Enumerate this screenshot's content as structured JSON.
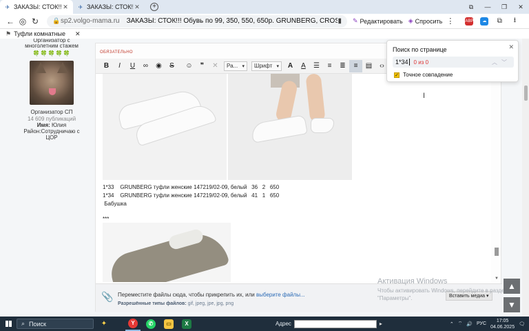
{
  "tabs": [
    {
      "label": "ЗАКАЗЫ: СТОК!!! Обувь",
      "active": true
    },
    {
      "label": "ЗАКАЗЫ: СТОК!!! Обувь",
      "active": false
    }
  ],
  "window": {
    "minimize": "—",
    "maximize": "❐",
    "close": "✕",
    "tab_list": "⧉"
  },
  "address": {
    "domain": "sp2.volgo-mama.ru",
    "page_title": "ЗАКАЗЫ: СТОК!!! Обувь по 99, 350, 550, 650р. GRUNBERG, CROSBY, KEDD...",
    "edit_label": "Редактировать",
    "ask_label": "Спросить",
    "abp": "ABP"
  },
  "bookmarks": [
    {
      "label": "Туфли комнатные"
    }
  ],
  "sidebar": {
    "role_line1": "Организатор с",
    "role_line2": "многолетним стажем",
    "stars": "🍀🍀🍀🍀🍀",
    "title": "Организатор СП",
    "posts": "14 609 публикаций",
    "name_label": "Имя:",
    "name_value": "Юлия",
    "district_label": "Район:",
    "district_value": "Сотрудничаю с ЦОР"
  },
  "editor": {
    "required_label": "ОБЯЗАТЕЛЬНО",
    "size_select": "Ра...",
    "font_select": "Шрифт",
    "rows": [
      "1*33    GRUNBERG туфли женские 147219/02-09, белый   36   2   650",
      "1*34    GRUNBERG туфли женские 147219/02-09, белый   41   1   650",
      " Бабушка",
      "***"
    ]
  },
  "dropzone": {
    "message": "Переместите файлы сюда, чтобы прикрепить их, или ",
    "link": "выберите файлы...",
    "types_label": "Разрешённые типы файлов:",
    "types": " gif, jpeg, jpe, jpg, png",
    "insert_media": "Вставить медиа ▾"
  },
  "watermark": {
    "line1": "Активация Windows",
    "line2": "Чтобы активировать Windows, перейдите в раздел",
    "line3": "\"Параметры\"."
  },
  "findbar": {
    "title": "Поиск по странице",
    "query": "1*34",
    "count": "0 из 0",
    "match_case_label": "Точное совпадение",
    "match_case_checked": true
  },
  "taskbar": {
    "search_placeholder": "Поиск",
    "addr_label": "Адрес",
    "lang": "РУС",
    "time": "17:05",
    "date": "04.06.2025"
  },
  "colors": {
    "accent_link": "#2b6bb6",
    "required_red": "#c0392b",
    "find_count_red": "#dd3333",
    "checkbox_yellow": "#f2c200"
  }
}
